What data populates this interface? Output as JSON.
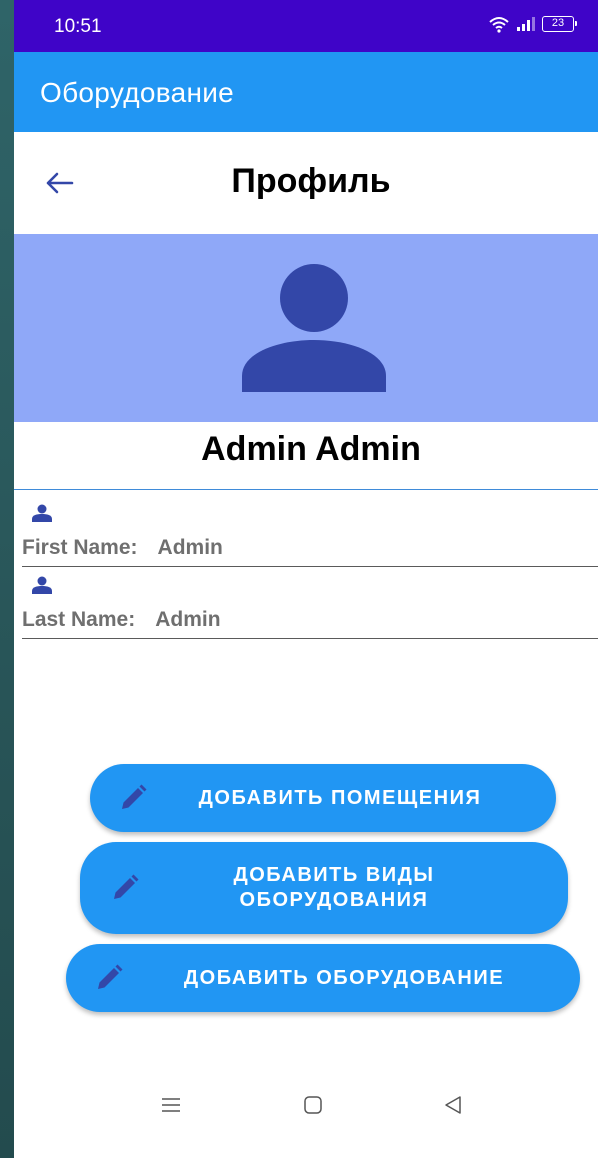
{
  "status_bar": {
    "time": "10:51",
    "battery": "23",
    "icons": [
      "wifi-icon",
      "signal-icon",
      "battery-icon"
    ]
  },
  "app_bar": {
    "title": "Оборудование"
  },
  "header": {
    "back_icon": "back-arrow-icon",
    "title": "Профиль"
  },
  "profile": {
    "avatar_icon": "person-icon",
    "full_name": "Admin Admin"
  },
  "fields": [
    {
      "label": "First Name:",
      "value": "Admin",
      "icon": "person-icon"
    },
    {
      "label": "Last Name:",
      "value": "Admin",
      "icon": "person-icon"
    }
  ],
  "actions": [
    {
      "label": "ДОБАВИТЬ ПОМЕЩЕНИЯ",
      "icon": "pencil-icon"
    },
    {
      "label": "ДОБАВИТЬ ВИДЫ ОБОРУДОВАНИЯ",
      "icon": "pencil-icon"
    },
    {
      "label": "ДОБАВИТЬ ОБОРУДОВАНИЕ",
      "icon": "pencil-icon"
    }
  ],
  "nav_bar": {
    "icons": [
      "menu-icon",
      "home-icon",
      "back-icon"
    ]
  },
  "colors": {
    "status_bar": "#3f04c8",
    "app_bar": "#2196f3",
    "avatar_panel": "#8fa8f8",
    "avatar_icon": "#3347a8",
    "button": "#2196f3"
  }
}
